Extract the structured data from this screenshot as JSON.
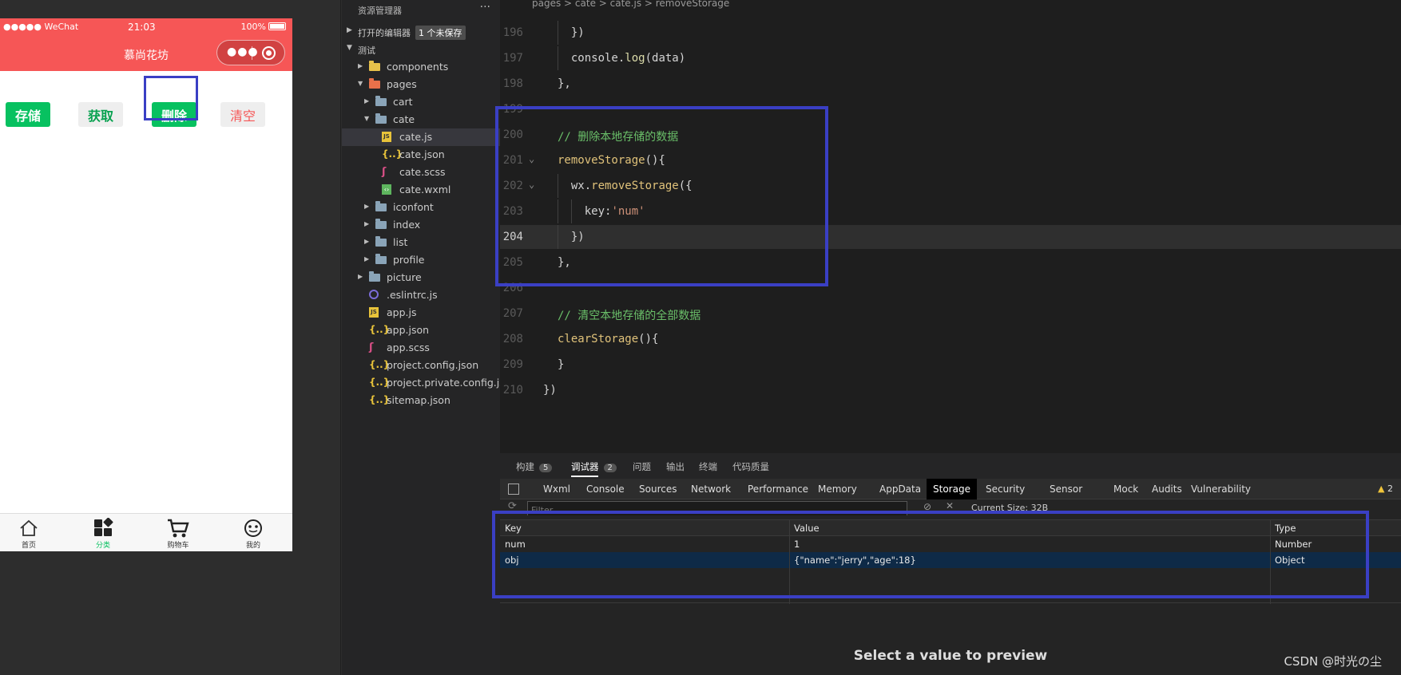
{
  "phone": {
    "status": {
      "carrier": "●●●●● WeChat",
      "time": "21:03",
      "battery": "100%"
    },
    "nav_title": "慕尚花坊",
    "buttons": {
      "store": "存储",
      "get": "获取",
      "delete": "删除",
      "clear": "清空"
    },
    "tabbar": [
      {
        "label": "首页",
        "icon": "home-icon"
      },
      {
        "label": "分类",
        "icon": "category-icon"
      },
      {
        "label": "购物车",
        "icon": "cart-icon"
      },
      {
        "label": "我的",
        "icon": "profile-icon"
      }
    ]
  },
  "explorer": {
    "title": "资源管理器",
    "more": "···",
    "open_editors": "打开的编辑器",
    "unsaved": "1 个未保存",
    "project": "测试",
    "tree": [
      {
        "name": "components",
        "icon": "folder-special"
      },
      {
        "name": "pages",
        "icon": "folder-red"
      },
      {
        "name": "cart",
        "icon": "folder"
      },
      {
        "name": "cate",
        "icon": "folder"
      },
      {
        "name": "cate.js",
        "icon": "js"
      },
      {
        "name": "cate.json",
        "icon": "json"
      },
      {
        "name": "cate.scss",
        "icon": "scss"
      },
      {
        "name": "cate.wxml",
        "icon": "wxml"
      },
      {
        "name": "iconfont",
        "icon": "folder"
      },
      {
        "name": "index",
        "icon": "folder"
      },
      {
        "name": "list",
        "icon": "folder"
      },
      {
        "name": "profile",
        "icon": "folder"
      },
      {
        "name": "picture",
        "icon": "folder"
      },
      {
        "name": ".eslintrc.js",
        "icon": "eslint"
      },
      {
        "name": "app.js",
        "icon": "js"
      },
      {
        "name": "app.json",
        "icon": "json"
      },
      {
        "name": "app.scss",
        "icon": "scss"
      },
      {
        "name": "project.config.json",
        "icon": "json"
      },
      {
        "name": "project.private.config.js...",
        "icon": "json"
      },
      {
        "name": "sitemap.json",
        "icon": "json"
      }
    ]
  },
  "editor": {
    "breadcrumb": "pages > cate > cate.js > removeStorage",
    "lines": [
      {
        "num": "196",
        "text": "  })"
      },
      {
        "num": "197",
        "text": "  console.log(data)"
      },
      {
        "num": "198",
        "text": "},"
      },
      {
        "num": "199",
        "text": ""
      },
      {
        "num": "200",
        "text": "// 删除本地存储的数据"
      },
      {
        "num": "201",
        "text": "removeStorage(){"
      },
      {
        "num": "202",
        "text": "  wx.removeStorage({"
      },
      {
        "num": "203",
        "text": "    key:'num'"
      },
      {
        "num": "204",
        "text": "  })"
      },
      {
        "num": "205",
        "text": "},"
      },
      {
        "num": "206",
        "text": ""
      },
      {
        "num": "207",
        "text": "// 清空本地存储的全部数据"
      },
      {
        "num": "208",
        "text": "clearStorage(){"
      },
      {
        "num": "209",
        "text": "}"
      },
      {
        "num": "210",
        "text": "})"
      }
    ]
  },
  "devtools": {
    "panel_tabs": [
      {
        "label": "构建",
        "count": "5"
      },
      {
        "label": "调试器",
        "count": "2"
      },
      {
        "label": "问题",
        "count": ""
      },
      {
        "label": "输出",
        "count": ""
      },
      {
        "label": "终端",
        "count": ""
      },
      {
        "label": "代码质量",
        "count": ""
      }
    ],
    "tabs": [
      "Wxml",
      "Console",
      "Sources",
      "Network",
      "Performance",
      "Memory",
      "AppData",
      "Storage",
      "Security",
      "Sensor",
      "Mock",
      "Audits",
      "Vulnerability"
    ],
    "warning_count": "2",
    "filter_placeholder": "Filter",
    "current_size": "Current Size: 32B",
    "table": {
      "headers": {
        "key": "Key",
        "value": "Value",
        "type": "Type"
      },
      "rows": [
        {
          "key": "num",
          "value": "1",
          "type": "Number"
        },
        {
          "key": "obj",
          "value": "{\"name\":\"jerry\",\"age\":18}",
          "type": "Object"
        }
      ]
    },
    "preview_message": "Select a value to preview"
  },
  "watermark": "CSDN @时光の尘",
  "colors": {
    "phone_header": "#f65656",
    "wechat_green": "#07c160",
    "highlight_box": "#3a3fc4"
  }
}
